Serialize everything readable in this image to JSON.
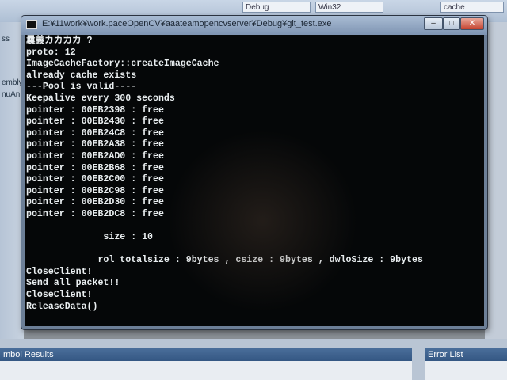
{
  "ide": {
    "config_combo": "Debug",
    "platform_combo": "Win32",
    "search_combo": "cache",
    "left_partial_labels": [
      "ss",
      "embly",
      "nuAn"
    ],
    "bottom_left_panel_title": "mbol Results",
    "bottom_right_panel_title": "Error List"
  },
  "console": {
    "title": "E:¥11work¥work.paceOpenCV¥aaateamopencvserver¥Debug¥git_test.exe",
    "lines": [
      "曩義カカカカ ?",
      "proto: 12",
      "ImageCacheFactory::createImageCache",
      "already cache exists",
      "---Pool is valid----",
      "Keepalive every 300 seconds",
      "pointer : 00EB2398 : free",
      "pointer : 00EB2430 : free",
      "pointer : 00EB24C8 : free",
      "pointer : 00EB2A38 : free",
      "pointer : 00EB2AD0 : free",
      "pointer : 00EB2B68 : free",
      "pointer : 00EB2C00 : free",
      "pointer : 00EB2C98 : free",
      "pointer : 00EB2D30 : free",
      "pointer : 00EB2DC8 : free",
      "",
      "              size : 10",
      "",
      "             rol totalsize : 9bytes , csize : 9bytes , dwloSize : 9bytes",
      "CloseClient!",
      "Send all packet!!",
      "CloseClient!",
      "ReleaseData()"
    ]
  }
}
